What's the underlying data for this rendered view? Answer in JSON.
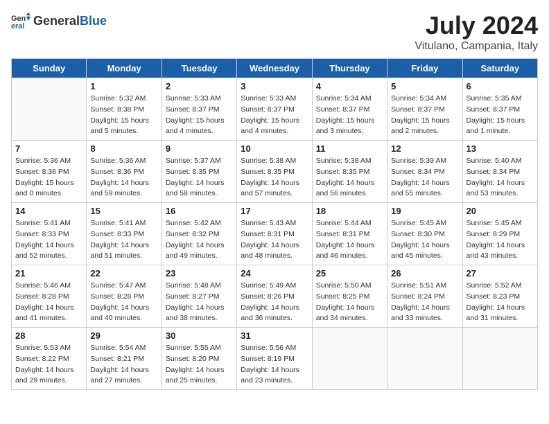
{
  "header": {
    "logo_general": "General",
    "logo_blue": "Blue",
    "month_title": "July 2024",
    "location": "Vitulano, Campania, Italy"
  },
  "days_of_week": [
    "Sunday",
    "Monday",
    "Tuesday",
    "Wednesday",
    "Thursday",
    "Friday",
    "Saturday"
  ],
  "weeks": [
    [
      {
        "day": "",
        "sunrise": "",
        "sunset": "",
        "daylight": ""
      },
      {
        "day": "1",
        "sunrise": "Sunrise: 5:32 AM",
        "sunset": "Sunset: 8:38 PM",
        "daylight": "Daylight: 15 hours and 5 minutes."
      },
      {
        "day": "2",
        "sunrise": "Sunrise: 5:33 AM",
        "sunset": "Sunset: 8:37 PM",
        "daylight": "Daylight: 15 hours and 4 minutes."
      },
      {
        "day": "3",
        "sunrise": "Sunrise: 5:33 AM",
        "sunset": "Sunset: 8:37 PM",
        "daylight": "Daylight: 15 hours and 4 minutes."
      },
      {
        "day": "4",
        "sunrise": "Sunrise: 5:34 AM",
        "sunset": "Sunset: 8:37 PM",
        "daylight": "Daylight: 15 hours and 3 minutes."
      },
      {
        "day": "5",
        "sunrise": "Sunrise: 5:34 AM",
        "sunset": "Sunset: 8:37 PM",
        "daylight": "Daylight: 15 hours and 2 minutes."
      },
      {
        "day": "6",
        "sunrise": "Sunrise: 5:35 AM",
        "sunset": "Sunset: 8:37 PM",
        "daylight": "Daylight: 15 hours and 1 minute."
      }
    ],
    [
      {
        "day": "7",
        "sunrise": "Sunrise: 5:36 AM",
        "sunset": "Sunset: 8:36 PM",
        "daylight": "Daylight: 15 hours and 0 minutes."
      },
      {
        "day": "8",
        "sunrise": "Sunrise: 5:36 AM",
        "sunset": "Sunset: 8:36 PM",
        "daylight": "Daylight: 14 hours and 59 minutes."
      },
      {
        "day": "9",
        "sunrise": "Sunrise: 5:37 AM",
        "sunset": "Sunset: 8:35 PM",
        "daylight": "Daylight: 14 hours and 58 minutes."
      },
      {
        "day": "10",
        "sunrise": "Sunrise: 5:38 AM",
        "sunset": "Sunset: 8:35 PM",
        "daylight": "Daylight: 14 hours and 57 minutes."
      },
      {
        "day": "11",
        "sunrise": "Sunrise: 5:38 AM",
        "sunset": "Sunset: 8:35 PM",
        "daylight": "Daylight: 14 hours and 56 minutes."
      },
      {
        "day": "12",
        "sunrise": "Sunrise: 5:39 AM",
        "sunset": "Sunset: 8:34 PM",
        "daylight": "Daylight: 14 hours and 55 minutes."
      },
      {
        "day": "13",
        "sunrise": "Sunrise: 5:40 AM",
        "sunset": "Sunset: 8:34 PM",
        "daylight": "Daylight: 14 hours and 53 minutes."
      }
    ],
    [
      {
        "day": "14",
        "sunrise": "Sunrise: 5:41 AM",
        "sunset": "Sunset: 8:33 PM",
        "daylight": "Daylight: 14 hours and 52 minutes."
      },
      {
        "day": "15",
        "sunrise": "Sunrise: 5:41 AM",
        "sunset": "Sunset: 8:33 PM",
        "daylight": "Daylight: 14 hours and 51 minutes."
      },
      {
        "day": "16",
        "sunrise": "Sunrise: 5:42 AM",
        "sunset": "Sunset: 8:32 PM",
        "daylight": "Daylight: 14 hours and 49 minutes."
      },
      {
        "day": "17",
        "sunrise": "Sunrise: 5:43 AM",
        "sunset": "Sunset: 8:31 PM",
        "daylight": "Daylight: 14 hours and 48 minutes."
      },
      {
        "day": "18",
        "sunrise": "Sunrise: 5:44 AM",
        "sunset": "Sunset: 8:31 PM",
        "daylight": "Daylight: 14 hours and 46 minutes."
      },
      {
        "day": "19",
        "sunrise": "Sunrise: 5:45 AM",
        "sunset": "Sunset: 8:30 PM",
        "daylight": "Daylight: 14 hours and 45 minutes."
      },
      {
        "day": "20",
        "sunrise": "Sunrise: 5:45 AM",
        "sunset": "Sunset: 8:29 PM",
        "daylight": "Daylight: 14 hours and 43 minutes."
      }
    ],
    [
      {
        "day": "21",
        "sunrise": "Sunrise: 5:46 AM",
        "sunset": "Sunset: 8:28 PM",
        "daylight": "Daylight: 14 hours and 41 minutes."
      },
      {
        "day": "22",
        "sunrise": "Sunrise: 5:47 AM",
        "sunset": "Sunset: 8:28 PM",
        "daylight": "Daylight: 14 hours and 40 minutes."
      },
      {
        "day": "23",
        "sunrise": "Sunrise: 5:48 AM",
        "sunset": "Sunset: 8:27 PM",
        "daylight": "Daylight: 14 hours and 38 minutes."
      },
      {
        "day": "24",
        "sunrise": "Sunrise: 5:49 AM",
        "sunset": "Sunset: 8:26 PM",
        "daylight": "Daylight: 14 hours and 36 minutes."
      },
      {
        "day": "25",
        "sunrise": "Sunrise: 5:50 AM",
        "sunset": "Sunset: 8:25 PM",
        "daylight": "Daylight: 14 hours and 34 minutes."
      },
      {
        "day": "26",
        "sunrise": "Sunrise: 5:51 AM",
        "sunset": "Sunset: 8:24 PM",
        "daylight": "Daylight: 14 hours and 33 minutes."
      },
      {
        "day": "27",
        "sunrise": "Sunrise: 5:52 AM",
        "sunset": "Sunset: 8:23 PM",
        "daylight": "Daylight: 14 hours and 31 minutes."
      }
    ],
    [
      {
        "day": "28",
        "sunrise": "Sunrise: 5:53 AM",
        "sunset": "Sunset: 8:22 PM",
        "daylight": "Daylight: 14 hours and 29 minutes."
      },
      {
        "day": "29",
        "sunrise": "Sunrise: 5:54 AM",
        "sunset": "Sunset: 8:21 PM",
        "daylight": "Daylight: 14 hours and 27 minutes."
      },
      {
        "day": "30",
        "sunrise": "Sunrise: 5:55 AM",
        "sunset": "Sunset: 8:20 PM",
        "daylight": "Daylight: 14 hours and 25 minutes."
      },
      {
        "day": "31",
        "sunrise": "Sunrise: 5:56 AM",
        "sunset": "Sunset: 8:19 PM",
        "daylight": "Daylight: 14 hours and 23 minutes."
      },
      {
        "day": "",
        "sunrise": "",
        "sunset": "",
        "daylight": ""
      },
      {
        "day": "",
        "sunrise": "",
        "sunset": "",
        "daylight": ""
      },
      {
        "day": "",
        "sunrise": "",
        "sunset": "",
        "daylight": ""
      }
    ]
  ]
}
